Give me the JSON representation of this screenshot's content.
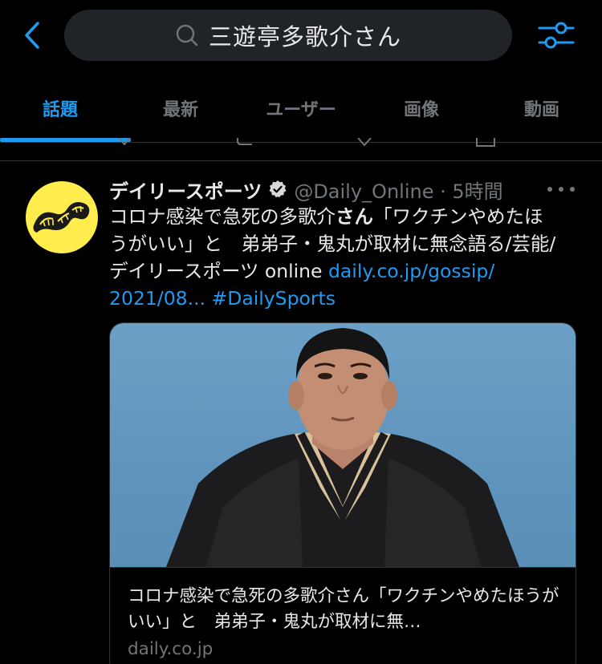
{
  "search": {
    "query": "三遊亭多歌介さん"
  },
  "tabs": [
    {
      "label": "話題"
    },
    {
      "label": "最新"
    },
    {
      "label": "ユーザー"
    },
    {
      "label": "画像"
    },
    {
      "label": "動画"
    }
  ],
  "active_tab": "話題",
  "colors": {
    "accent": "#1d9bf0",
    "background": "#000000",
    "muted": "#71767b",
    "avatar": "#ffed4d"
  },
  "tweet": {
    "display_name": "デイリースポーツ",
    "handle_time": "@Daily_Online · 5時間",
    "body": {
      "line1_pre": "コロナ感染で急死の多歌介",
      "line1_bold": "さん",
      "line1_post": "「ワクチンやめたほ",
      "line2": "うがいい」と　弟弟子・鬼丸が取材に無念語る/芸能/",
      "line3_pre": "デイリースポーツ online ",
      "link1": "daily.co.jp/gossip/",
      "link2": "2021/08...",
      "hashtag": "#DailySports"
    },
    "card": {
      "title": "コロナ感染で急死の多歌介さん「ワクチンやめたほうがいい」と　弟弟子・鬼丸が取材に無…",
      "domain": "daily.co.jp"
    }
  }
}
